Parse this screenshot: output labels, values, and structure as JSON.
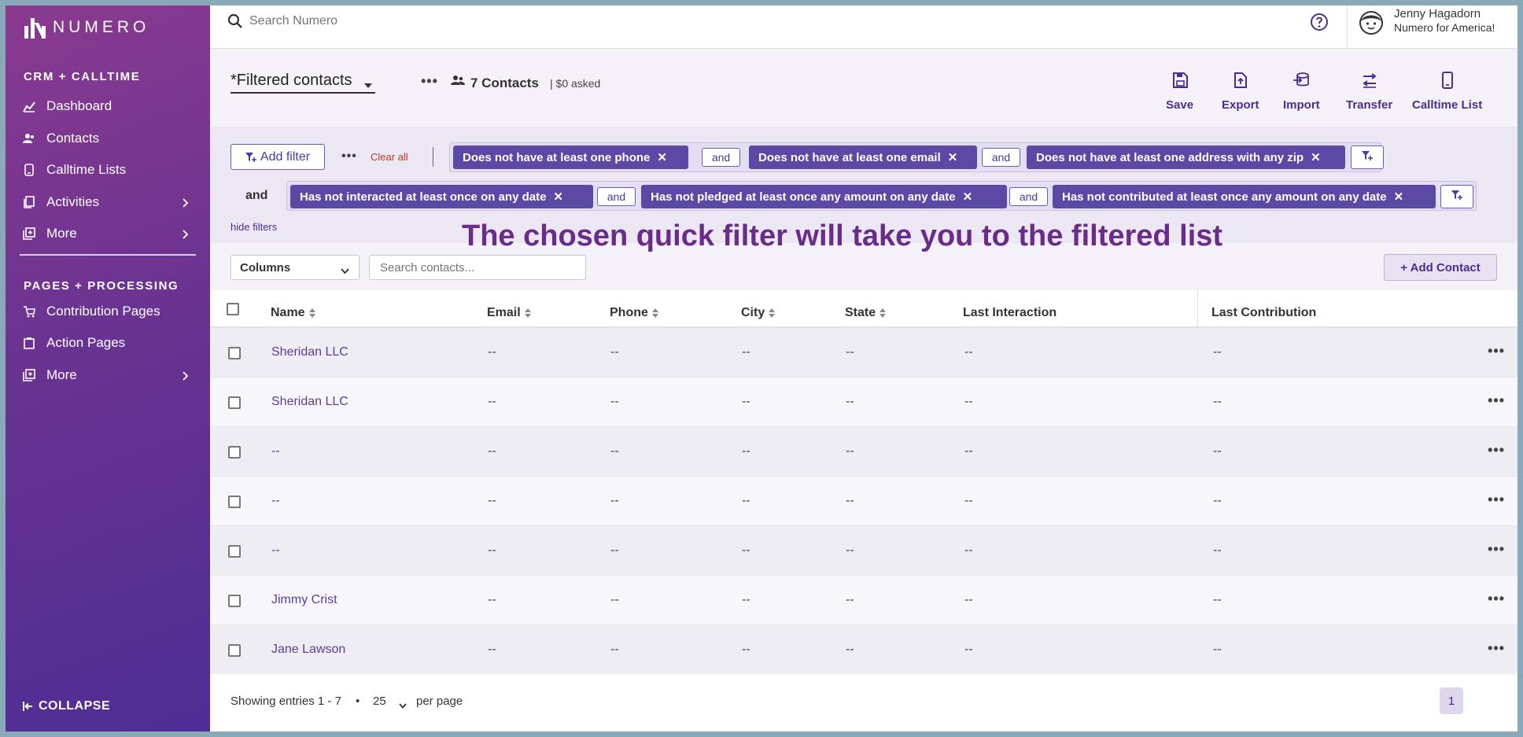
{
  "app": {
    "logo_text": "NUMERO"
  },
  "colors": {
    "sidebar_top": "#8a3a8f",
    "sidebar_bottom": "#4e2d94",
    "accent": "#4b2d8f",
    "chip": "#5a4aa6",
    "danger": "#c0392b"
  },
  "sidebar": {
    "section1": "CRM + CALLTIME",
    "items1": [
      {
        "label": "Dashboard",
        "icon": "chart-icon"
      },
      {
        "label": "Contacts",
        "icon": "people-icon"
      },
      {
        "label": "Calltime Lists",
        "icon": "phone-list-icon"
      },
      {
        "label": "Activities",
        "icon": "activities-icon"
      },
      {
        "label": "More",
        "icon": "more-icon"
      }
    ],
    "section2": "PAGES + PROCESSING",
    "items2": [
      {
        "label": "Contribution Pages",
        "icon": "cart-icon"
      },
      {
        "label": "Action Pages",
        "icon": "clipboard-icon"
      },
      {
        "label": "More",
        "icon": "more-icon"
      }
    ],
    "collapse": "COLLAPSE"
  },
  "topbar": {
    "search_placeholder": "Search Numero",
    "user_name": "Jenny Hagadorn",
    "user_org": "Numero for America!"
  },
  "header": {
    "list_name": "*Filtered contacts",
    "contact_count": "7 Contacts",
    "asked": "| $0 asked",
    "tools": {
      "save": "Save",
      "export": "Export",
      "import": "Import",
      "transfer": "Transfer",
      "calltime": "Calltime List"
    }
  },
  "filters": {
    "add_filter": "Add filter",
    "clear_all": "Clear all",
    "group_and": "and",
    "and": "and",
    "group1": [
      "Does not have at least one phone",
      "Does not have at least one email",
      "Does not have at least one address with any zip"
    ],
    "group2": [
      "Has not interacted at least once on any date",
      "Has not pledged at least once any amount on any date",
      "Has not contributed at least once any amount on any date"
    ],
    "hide": "hide filters"
  },
  "annotation": "The chosen quick filter will take you to the filtered list",
  "controls": {
    "columns": "Columns",
    "search_placeholder": "Search contacts...",
    "add_contact": "+ Add Contact"
  },
  "table": {
    "columns": [
      "Name",
      "Email",
      "Phone",
      "City",
      "State",
      "Last Interaction",
      "Last Contribution"
    ],
    "rows": [
      {
        "name": "Sheridan LLC",
        "email": "--",
        "phone": "--",
        "city": "--",
        "state": "--",
        "last_interaction": "--",
        "last_contribution": "--"
      },
      {
        "name": "Sheridan LLC",
        "email": "--",
        "phone": "--",
        "city": "--",
        "state": "--",
        "last_interaction": "--",
        "last_contribution": "--"
      },
      {
        "name": "--",
        "email": "--",
        "phone": "--",
        "city": "--",
        "state": "--",
        "last_interaction": "--",
        "last_contribution": "--"
      },
      {
        "name": "--",
        "email": "--",
        "phone": "--",
        "city": "--",
        "state": "--",
        "last_interaction": "--",
        "last_contribution": "--"
      },
      {
        "name": "--",
        "email": "--",
        "phone": "--",
        "city": "--",
        "state": "--",
        "last_interaction": "--",
        "last_contribution": "--"
      },
      {
        "name": "Jimmy Crist",
        "email": "--",
        "phone": "--",
        "city": "--",
        "state": "--",
        "last_interaction": "--",
        "last_contribution": "--"
      },
      {
        "name": "Jane Lawson",
        "email": "--",
        "phone": "--",
        "city": "--",
        "state": "--",
        "last_interaction": "--",
        "last_contribution": "--"
      }
    ]
  },
  "footer": {
    "showing": "Showing entries 1 - 7",
    "bullet": "•",
    "per_page_value": "25",
    "per_page": "per page",
    "page": "1"
  }
}
